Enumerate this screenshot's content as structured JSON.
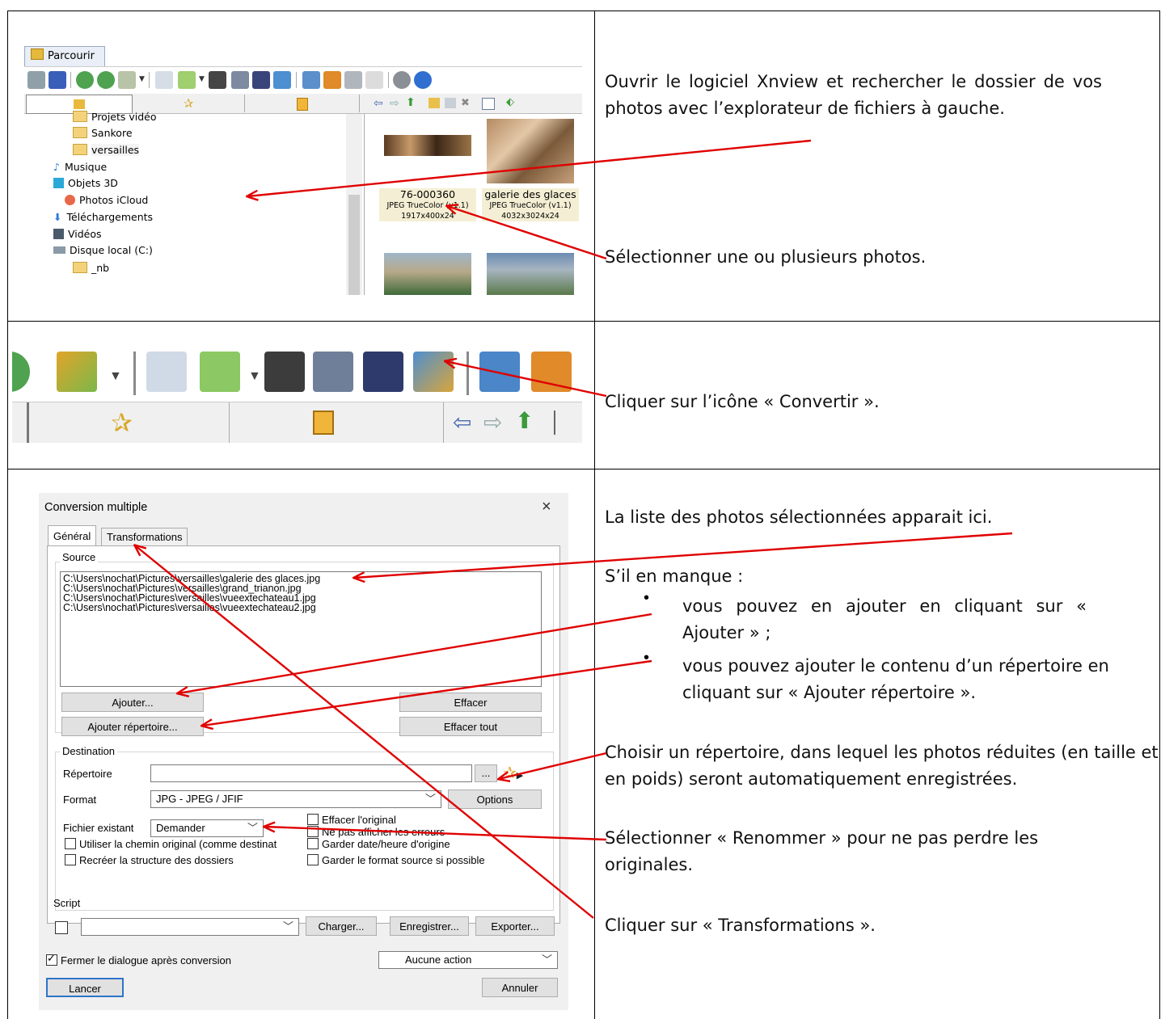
{
  "steps": {
    "s1": "Ouvrir le logiciel Xnview et rechercher le dossier de vos photos avec l’explorateur de fichiers à gauche.",
    "s2": "Sélectionner une ou plusieurs photos.",
    "s3": "Cliquer sur l’icône « Convertir ».",
    "s4": "La liste des photos sélectionnées apparait ici.",
    "s5": "S’il  en  manque :",
    "s5_b1": "vous  pouvez  en  ajouter  en  cliquant sur « Ajouter » ;",
    "s5_b2": "vous pouvez ajouter le contenu d’un répertoire en cliquant sur « Ajouter répertoire ».",
    "s6": "Choisir un répertoire, dans lequel les photos réduites (en taille et en poids) seront automatiquement enregistrées.",
    "s7": "Sélectionner « Renommer » pour ne pas perdre les originales.",
    "s8": "Cliquer sur « Transformations »."
  },
  "browser": {
    "tab_label": "Parcourir",
    "tree": [
      "Projets vidéo",
      "Sankore",
      "versailles",
      "Musique",
      "Objets 3D",
      "Photos iCloud",
      "Téléchargements",
      "Vidéos",
      "Disque local (C:)",
      "_nb"
    ],
    "thumbs": [
      {
        "name": "76-000360",
        "info": "JPEG TrueColor (v1.1)",
        "size": "1917x400x24"
      },
      {
        "name": "galerie des glaces",
        "info": "JPEG TrueColor (v1.1)",
        "size": "4032x3024x24"
      }
    ]
  },
  "dialog": {
    "title": "Conversion multiple",
    "close": "×",
    "tabs": [
      "Général",
      "Transformations"
    ],
    "source_label": "Source",
    "files": [
      "C:\\Users\\nochat\\Pictures\\versailles\\galerie des glaces.jpg",
      "C:\\Users\\nochat\\Pictures\\versailles\\grand_trianon.jpg",
      "C:\\Users\\nochat\\Pictures\\versailles\\vueextechateau1.jpg",
      "C:\\Users\\nochat\\Pictures\\versailles\\vueextechateau2.jpg"
    ],
    "btn_add": "Ajouter...",
    "btn_add_dir": "Ajouter répertoire...",
    "btn_clear": "Effacer",
    "btn_clear_all": "Effacer tout",
    "dest_label": "Destination",
    "dir_label": "Répertoire",
    "dir_browse": "...",
    "format_label": "Format",
    "format_value": "JPG - JPEG / JFIF",
    "btn_options": "Options",
    "existing_label": "Fichier existant",
    "existing_value": "Demander",
    "cb_delete_original": "Effacer l'original",
    "cb_no_errors": "Ne pas afficher les erreurs",
    "cb_keep_date": "Garder date/heure d'origine",
    "cb_keep_format": "Garder le format source si possible",
    "cb_use_path": "Utiliser la chemin original (comme destinat",
    "cb_recreate": "Recréer la structure des dossiers",
    "script_label": "Script",
    "btn_load": "Charger...",
    "btn_save": "Enregistrer...",
    "btn_export": "Exporter...",
    "cb_close_after": "Fermer le dialogue après conversion",
    "action_value": "Aucune action",
    "btn_run": "Lancer",
    "btn_cancel": "Annuler"
  },
  "colors": {
    "arrow": "#e00000",
    "grid": "#000000"
  }
}
